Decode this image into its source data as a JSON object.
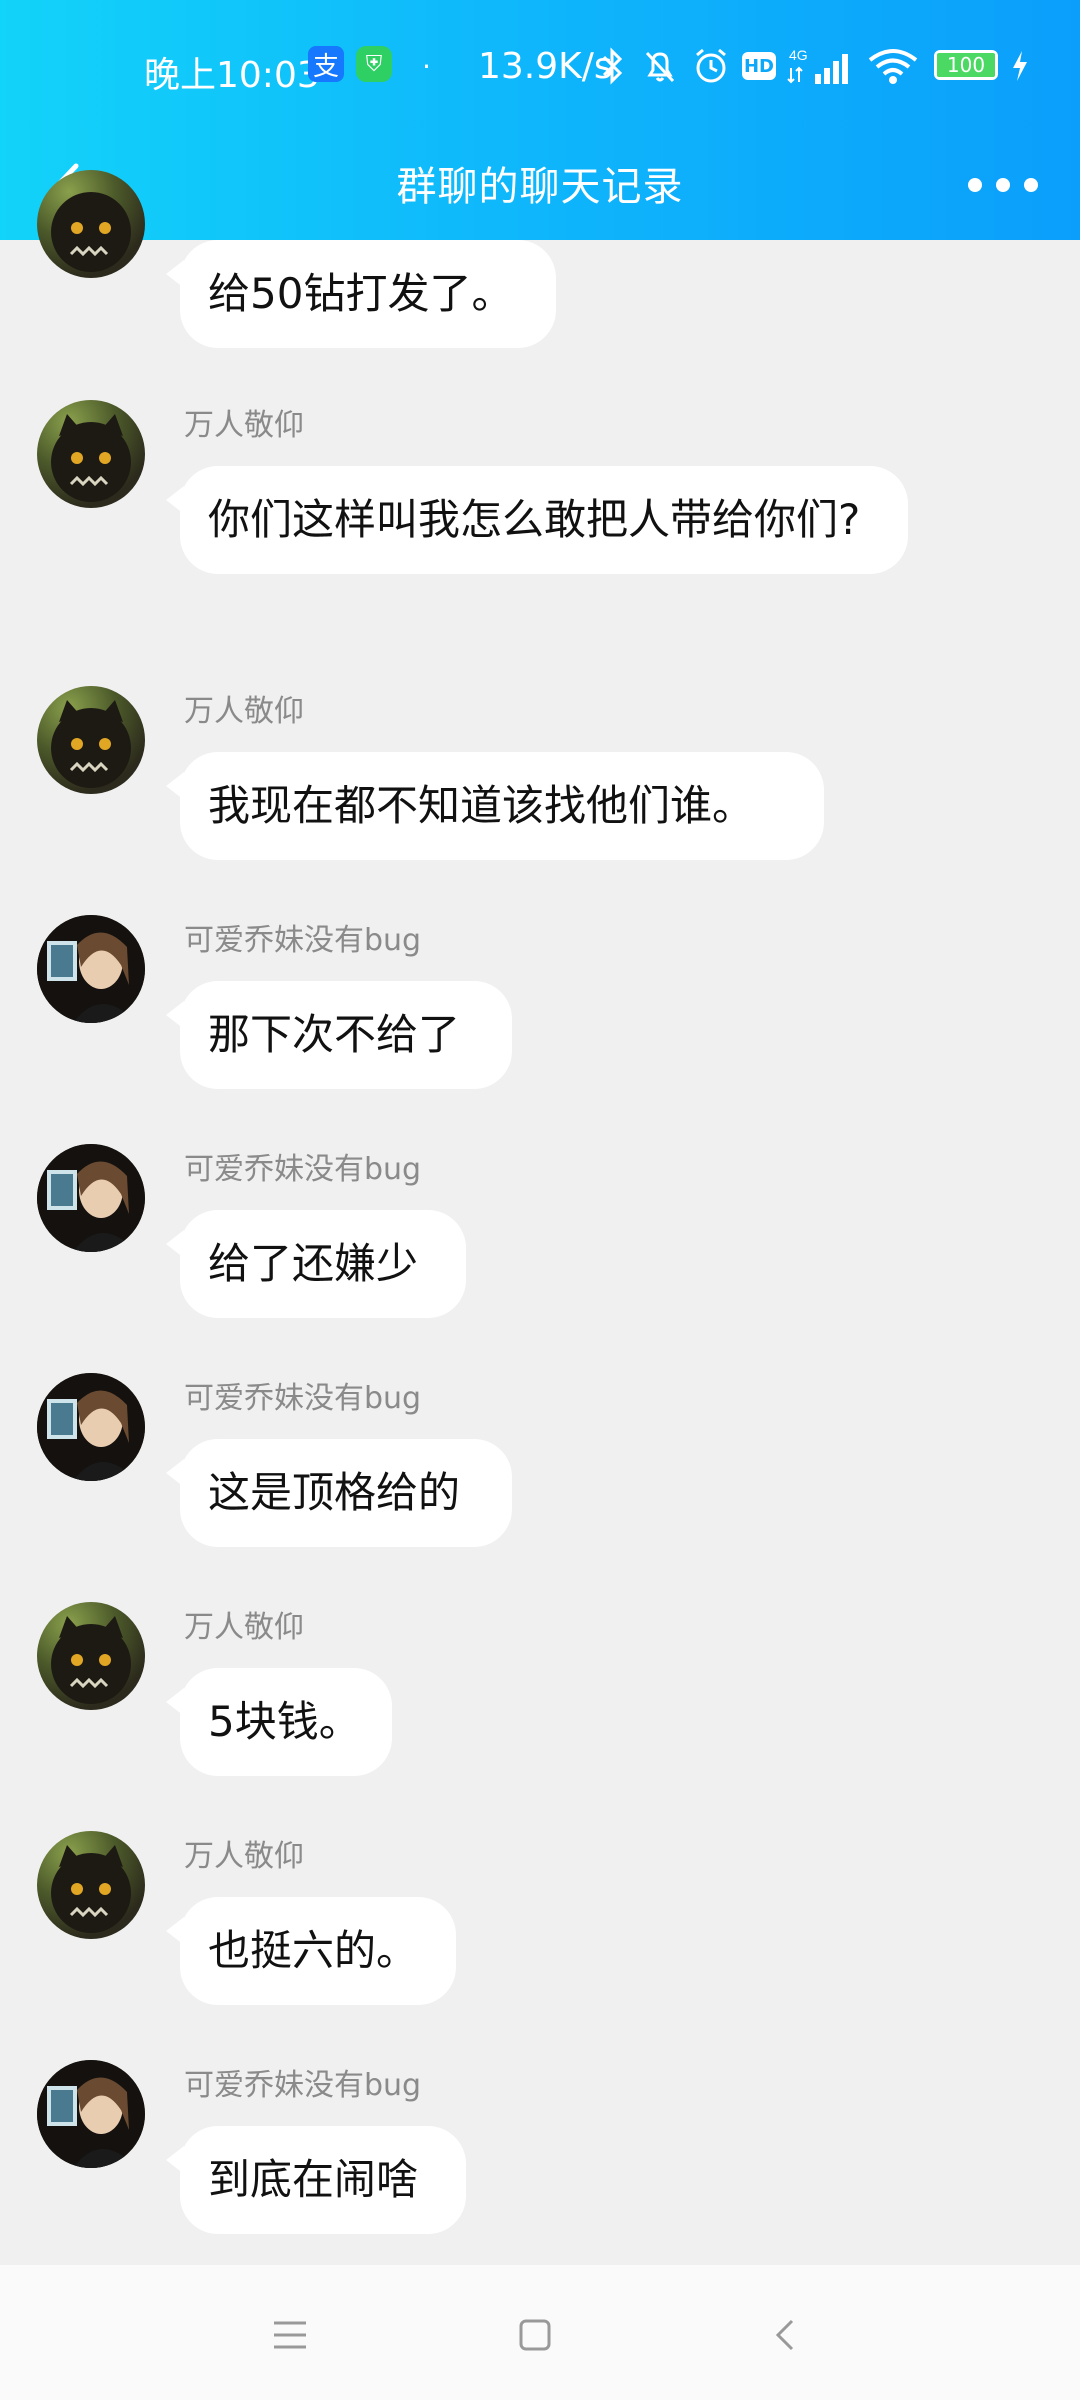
{
  "status_bar": {
    "time": "晚上10:03",
    "alipay_icon": "alipay-icon",
    "speed": "13.9K/s",
    "network": "4G",
    "battery": "100"
  },
  "header": {
    "title": "群聊的聊天记录"
  },
  "messages": [
    {
      "sender": "",
      "text": "给50钻打发了。"
    },
    {
      "sender": "万人敬仰",
      "text": "你们这样叫我怎么敢把人带给你们?"
    },
    {
      "sender": "万人敬仰",
      "text": "我现在都不知道该找他们谁。"
    },
    {
      "sender": "可爱乔妹没有bug",
      "text": "那下次不给了"
    },
    {
      "sender": "可爱乔妹没有bug",
      "text": "给了还嫌少"
    },
    {
      "sender": "可爱乔妹没有bug",
      "text": "这是顶格给的"
    },
    {
      "sender": "万人敬仰",
      "text": "5块钱。"
    },
    {
      "sender": "万人敬仰",
      "text": "也挺六的。"
    },
    {
      "sender": "可爱乔妹没有bug",
      "text": "到底在闹啥"
    }
  ],
  "colors": {
    "header_start": "#12d3f9",
    "header_end": "#0b9ffb",
    "background": "#f0f0f0",
    "bubble": "#ffffff"
  }
}
